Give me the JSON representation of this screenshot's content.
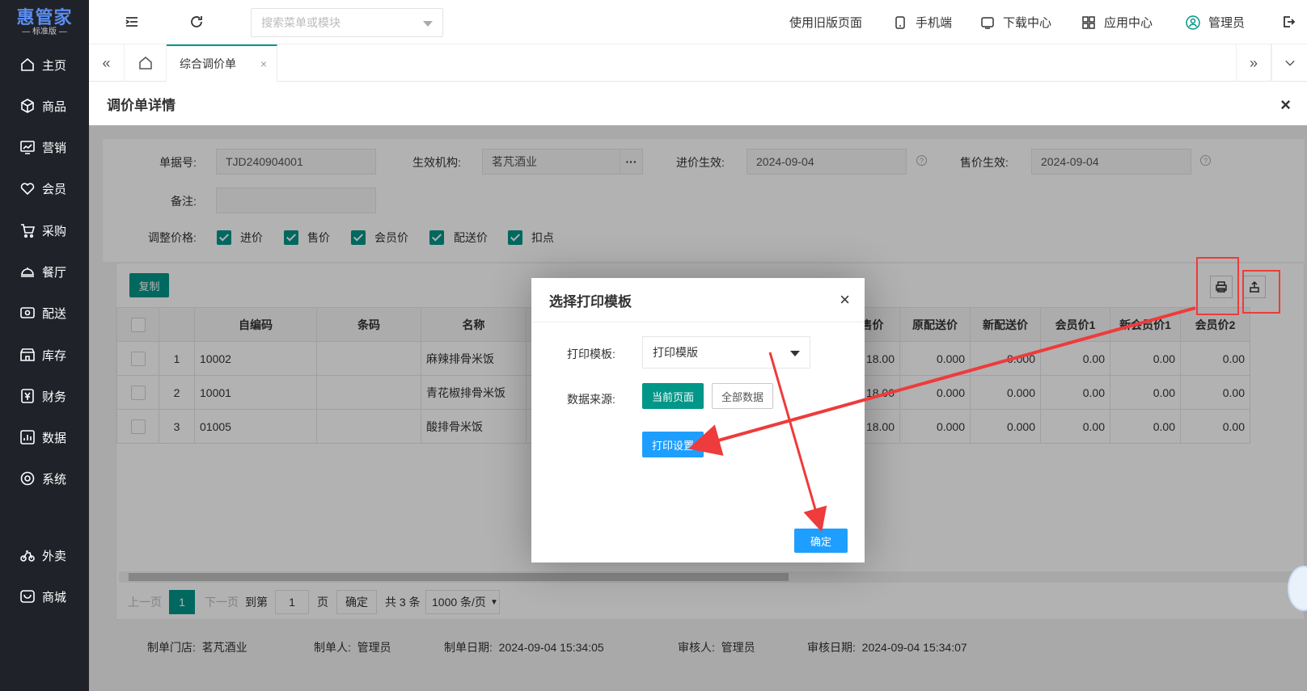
{
  "app": {
    "brand": "惠管家",
    "edition": "标准版"
  },
  "sidebar": {
    "items": [
      {
        "label": "主页",
        "icon": "home-icon"
      },
      {
        "label": "商品",
        "icon": "box-icon"
      },
      {
        "label": "营销",
        "icon": "chart-icon"
      },
      {
        "label": "会员",
        "icon": "heart-icon"
      },
      {
        "label": "采购",
        "icon": "cart-icon"
      },
      {
        "label": "餐厅",
        "icon": "dish-icon"
      },
      {
        "label": "配送",
        "icon": "delivery-icon"
      },
      {
        "label": "库存",
        "icon": "store-icon"
      },
      {
        "label": "财务",
        "icon": "yen-icon"
      },
      {
        "label": "数据",
        "icon": "stats-icon"
      },
      {
        "label": "系统",
        "icon": "settings-icon"
      },
      {
        "label": "外卖",
        "icon": "bike-icon"
      },
      {
        "label": "商城",
        "icon": "mall-icon"
      }
    ]
  },
  "header": {
    "search_placeholder": "搜索菜单或模块",
    "old_version": "使用旧版页面",
    "mobile": "手机端",
    "download": "下载中心",
    "apps": "应用中心",
    "user": "管理员"
  },
  "tabs": {
    "active": "综合调价单",
    "close": "×"
  },
  "page": {
    "title": "调价单详情",
    "close": "×",
    "form": {
      "doc_no_label": "单据号:",
      "doc_no": "TJD240904001",
      "org_label": "生效机构:",
      "org": "茗芃酒业",
      "org_more": "···",
      "buy_eff_label": "进价生效:",
      "buy_eff": "2024-09-04",
      "sell_eff_label": "售价生效:",
      "sell_eff": "2024-09-04",
      "help": "?",
      "remark_label": "备注:",
      "remark": "",
      "adjust_label": "调整价格:",
      "checks": [
        "进价",
        "售价",
        "会员价",
        "配送价",
        "扣点"
      ]
    },
    "table": {
      "copy_label": "复制",
      "columns": [
        "",
        "",
        "自编码",
        "条码",
        "名称",
        "",
        "新售价",
        "原配送价",
        "新配送价",
        "会员价1",
        "新会员价1",
        "会员价2"
      ],
      "rows": [
        {
          "idx": "1",
          "code": "10002",
          "barcode": "",
          "name": "麻辣排骨米饭",
          "new_price": "18.00",
          "old_dist": "0.000",
          "new_dist": "0.000",
          "mp1": "0.00",
          "new_mp1": "0.00",
          "mp2": "0.00"
        },
        {
          "idx": "2",
          "code": "10001",
          "barcode": "",
          "name": "青花椒排骨米饭",
          "new_price": "18.00",
          "old_dist": "0.000",
          "new_dist": "0.000",
          "mp1": "0.00",
          "new_mp1": "0.00",
          "mp2": "0.00"
        },
        {
          "idx": "3",
          "code": "01005",
          "barcode": "",
          "name": "酸排骨米饭",
          "new_price": "18.00",
          "old_dist": "0.000",
          "new_dist": "0.000",
          "mp1": "0.00",
          "new_mp1": "0.00",
          "mp2": "0.00"
        }
      ]
    },
    "pager": {
      "prev": "上一页",
      "current": "1",
      "next": "下一页",
      "goto": "到第",
      "page_input": "1",
      "page_unit": "页",
      "confirm": "确定",
      "total": "共 3 条",
      "page_size": "1000 条/页"
    },
    "footer": {
      "store_label": "制单门店:",
      "store": "茗芃酒业",
      "maker_label": "制单人:",
      "maker": "管理员",
      "make_date_label": "制单日期:",
      "make_date": "2024-09-04 15:34:05",
      "auditor_label": "审核人:",
      "auditor": "管理员",
      "audit_date_label": "审核日期:",
      "audit_date": "2024-09-04 15:34:07"
    }
  },
  "dialog": {
    "title": "选择打印模板",
    "close": "×",
    "template_label": "打印模板:",
    "template_value": "打印模版",
    "source_label": "数据来源:",
    "current_page": "当前页面",
    "all_data": "全部数据",
    "print_settings": "打印设置",
    "ok": "确定"
  },
  "colors": {
    "accent": "#009688",
    "primary_blue": "#1e9fff",
    "annotation_red": "#ee3b3b",
    "sidebar_bg": "#1f2229"
  }
}
